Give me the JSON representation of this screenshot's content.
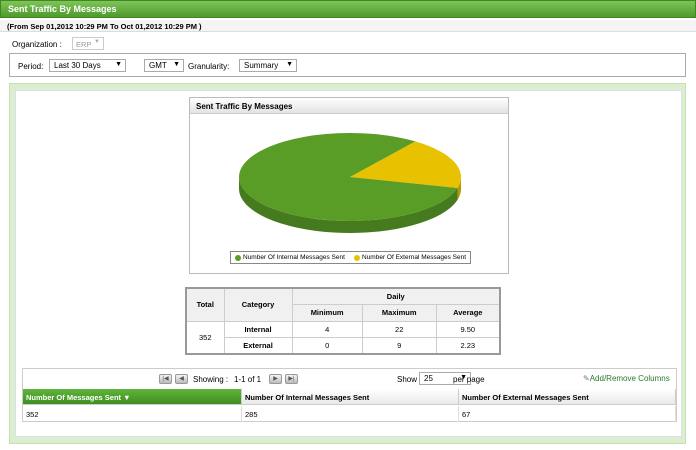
{
  "header": {
    "title": "Sent Traffic By Messages"
  },
  "date_range": "(From Sep 01,2012 10:29 PM To Oct 01,2012 10:29 PM )",
  "organization": {
    "label": "Organization :",
    "value": "ERP"
  },
  "filters": {
    "period_label": "Period:",
    "period_value": "Last 30 Days",
    "timezone_value": "GMT",
    "granularity_label": "Granularity:",
    "granularity_value": "Summary"
  },
  "chart": {
    "title": "Sent Traffic By Messages"
  },
  "chart_data": {
    "type": "pie",
    "title": "Sent Traffic By Messages",
    "categories": [
      "Number Of Internal Messages Sent",
      "Number Of External Messages Sent"
    ],
    "values": [
      285,
      67
    ],
    "colors": [
      "#5a9d26",
      "#e8c100"
    ],
    "legend_position": "bottom"
  },
  "stats": {
    "col_total": "Total",
    "col_category": "Category",
    "col_daily": "Daily",
    "col_min": "Minimum",
    "col_max": "Maximum",
    "col_avg": "Average",
    "total": "352",
    "rows": [
      {
        "category": "Internal",
        "min": "4",
        "max": "22",
        "avg": "9.50"
      },
      {
        "category": "External",
        "min": "0",
        "max": "9",
        "avg": "2.23"
      }
    ]
  },
  "pager": {
    "showing_label": "Showing :",
    "range": "1-1 of 1",
    "show_label": "Show",
    "per_page_value": "25",
    "per_page_label": "per page",
    "add_remove": "Add/Remove Columns"
  },
  "grid": {
    "headers": [
      "Number Of Messages Sent",
      "Number Of Internal Messages Sent",
      "Number Of External Messages Sent"
    ],
    "row": [
      "352",
      "285",
      "67"
    ]
  }
}
